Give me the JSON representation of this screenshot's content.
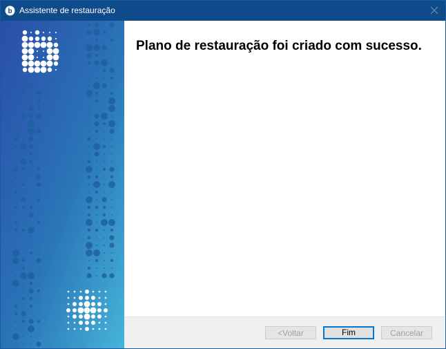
{
  "window": {
    "title": "Assistente de restauração",
    "app_icon": "restore-wizard-app-icon",
    "close_icon": "close-icon"
  },
  "banner": {
    "logo_icon": "dotted-b-logo-icon",
    "gradient_colors": [
      "#2a4ea8",
      "#2a76b8",
      "#46b4d8"
    ]
  },
  "main": {
    "headline": "Plano de restauração foi criado com sucesso."
  },
  "footer": {
    "back_label": "<Voltar",
    "finish_label": "Fim",
    "cancel_label": "Cancelar"
  },
  "colors": {
    "titlebar": "#0f4a8a",
    "focus_border": "#0078d7",
    "footer_bg": "#f0f0f0"
  }
}
